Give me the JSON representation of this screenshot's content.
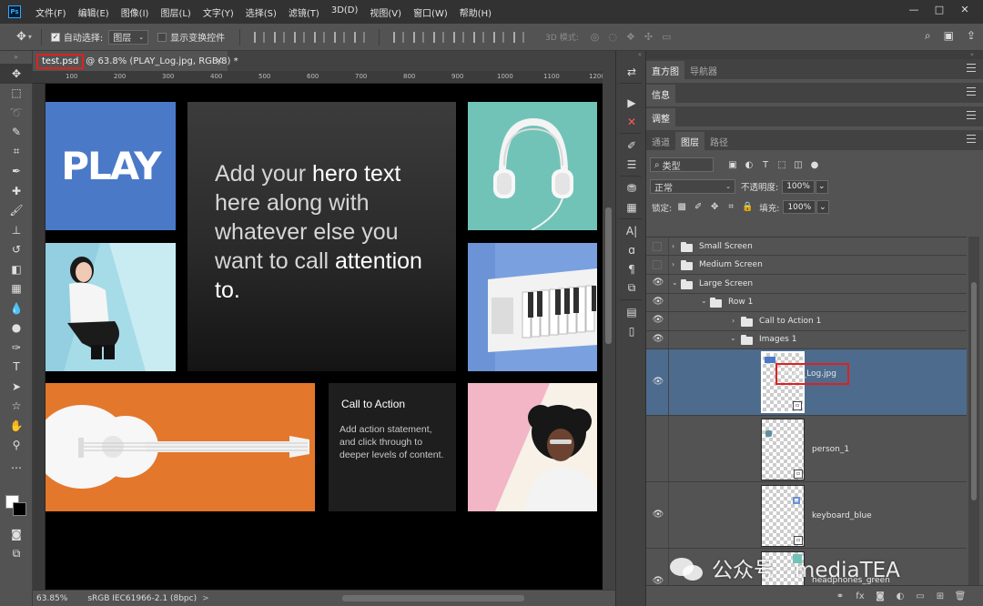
{
  "app": {
    "logo": "Ps"
  },
  "menu": [
    "文件(F)",
    "编辑(E)",
    "图像(I)",
    "图层(L)",
    "文字(Y)",
    "选择(S)",
    "滤镜(T)",
    "3D(D)",
    "视图(V)",
    "窗口(W)",
    "帮助(H)"
  ],
  "window_controls": {
    "minimize": "—",
    "restore": "□",
    "close": "✕"
  },
  "options": {
    "auto_select_label": "自动选择:",
    "auto_select_value": "图层",
    "show_transform_label": "显示变换控件",
    "mode_3d_label": "3D 模式:"
  },
  "document_tab": {
    "file_name": "test.psd",
    "info": "@ 63.8% (PLAY_Log.jpg, RGB/8) *",
    "close": "×"
  },
  "ruler": {
    "ticks": [
      "100",
      "200",
      "300",
      "400",
      "500",
      "600",
      "700",
      "800",
      "900",
      "1000",
      "1100",
      "1200"
    ]
  },
  "canvas": {
    "play_logo": "PLAY",
    "hero": {
      "line1_pre": "Add your ",
      "line1_bold": "hero text",
      "rest": "here along with whatever else you want to call",
      "last": "attention to."
    },
    "cta": {
      "title": "Call to Action",
      "body": "Add action statement, and click through to deeper levels of content."
    }
  },
  "status": {
    "zoom": "63.85%",
    "profile": "sRGB IEC61966-2.1 (8bpc)",
    "arrow": ">"
  },
  "panels": {
    "histogram_tabs": [
      "直方图",
      "导航器"
    ],
    "info_tab": "信息",
    "adjust_tab": "调整",
    "layers_tabs": [
      "通道",
      "图层",
      "路径"
    ],
    "filter_kind": "类型",
    "blend_mode": "正常",
    "opacity_label": "不透明度:",
    "opacity_value": "100%",
    "lock_label": "锁定:",
    "fill_label": "填充:",
    "fill_value": "100%"
  },
  "layers": [
    {
      "name": "Small Screen",
      "type": "group",
      "level": 0,
      "expanded": false,
      "visible": false
    },
    {
      "name": "Medium Screen",
      "type": "group",
      "level": 0,
      "expanded": false,
      "visible": false
    },
    {
      "name": "Large Screen",
      "type": "group",
      "level": 0,
      "expanded": true,
      "visible": true
    },
    {
      "name": "Row 1",
      "type": "group",
      "level": 1,
      "expanded": true,
      "visible": true
    },
    {
      "name": "Call to Action 1",
      "type": "group",
      "level": 2,
      "expanded": false,
      "visible": true
    },
    {
      "name": "Images 1",
      "type": "group",
      "level": 2,
      "expanded": true,
      "visible": true
    },
    {
      "name": "PLAY_Log.jpg",
      "type": "smart",
      "selected": true,
      "visible": true
    },
    {
      "name": "person_1",
      "type": "smart",
      "selected": false,
      "visible": false
    },
    {
      "name": "keyboard_blue",
      "type": "smart",
      "selected": false,
      "visible": true
    },
    {
      "name": "headphones_green",
      "type": "smart",
      "selected": false,
      "visible": true
    }
  ],
  "watermark": {
    "text": "公众号 · mediaTEA"
  },
  "colors": {
    "accent_red": "#e02020",
    "selection_blue": "#4d6b8d",
    "play_blue": "#4a79c7",
    "teal": "#71c3b8",
    "orange": "#e3772c",
    "pink": "#f2b6c6"
  }
}
